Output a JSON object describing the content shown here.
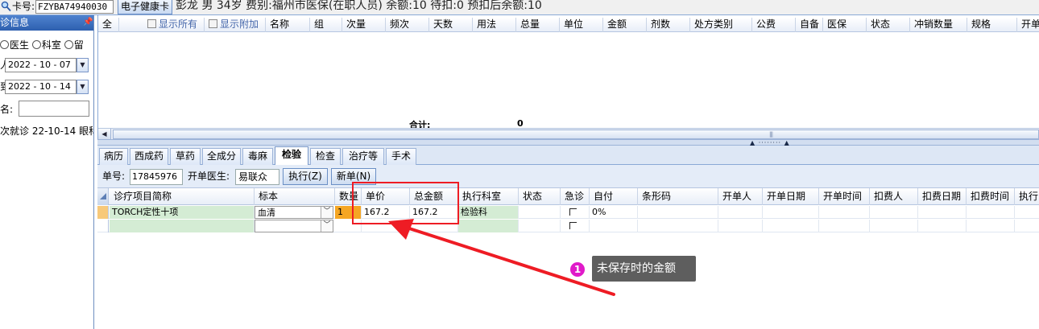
{
  "topbar": {
    "card_label": "卡号:",
    "card_no": "FZYBA74940030",
    "ehc_button": "电子健康卡",
    "patient_line": "彭龙  男  34岁  费别:福州市医保(在职人员)  余额:10  待扣:0  预扣后余额:10"
  },
  "left_panel": {
    "title": "诊信息",
    "pin": "ᚬ",
    "radio_doctor": "医生",
    "radio_dept": "科室",
    "radio_stay": "留",
    "date_from_prefix": "人",
    "date_from": "2022 - 10 - 07",
    "date_to_prefix": "到",
    "date_to": "2022 - 10 - 14",
    "name_label": "名:",
    "name_value": "",
    "visit_item": "次就诊 22-10-14 眼科"
  },
  "upper_grid": {
    "col_all": "全",
    "show_all": "显示所有",
    "show_extra": "显示附加",
    "columns": [
      "名称",
      "组",
      "次量",
      "频次",
      "天数",
      "用法",
      "总量",
      "单位",
      "金额",
      "剂数",
      "处方类别",
      "公费",
      "自备",
      "医保",
      "状态",
      "冲销数量",
      "规格",
      "开单"
    ],
    "total_label": "合计:",
    "total_value": "0"
  },
  "tabs": [
    "病历",
    "西成药",
    "草药",
    "全成分",
    "毒麻",
    "检验",
    "检查",
    "治疗等",
    "手术"
  ],
  "active_tab": "检验",
  "form": {
    "order_label": "单号:",
    "order_no": "17845976",
    "doctor_label": "开单医生:",
    "doctor_name": "易联众",
    "execute_button": "执行(Z)",
    "new_button": "新单(N)"
  },
  "lower_grid": {
    "columns": [
      "诊疗项目简称",
      "标本",
      "数量",
      "单价",
      "总金额",
      "执行科室",
      "状态",
      "急诊",
      "自付",
      "条形码",
      "开单人",
      "开单日期",
      "开单时间",
      "扣费人",
      "扣费日期",
      "扣费时间",
      "执行"
    ],
    "rows": [
      {
        "name": "TORCH定性十项",
        "specimen": "血清",
        "qty": "1",
        "unit_price": "167.2",
        "total": "167.2",
        "dept": "检验科",
        "status": "",
        "self_pay": "0%"
      },
      {
        "name": "",
        "specimen": "",
        "qty": "",
        "unit_price": "",
        "total": "",
        "dept": "",
        "status": "",
        "self_pay": ""
      }
    ]
  },
  "annotation": {
    "badge": "1",
    "note": "未保存时的金额"
  },
  "colors": {
    "highlight_red": "#ee1c24",
    "badge_magenta": "#e01ac9",
    "note_bg": "#5e5e5e",
    "title_blue": "#3a6cbd",
    "cell_green": "#d4ecd4"
  }
}
